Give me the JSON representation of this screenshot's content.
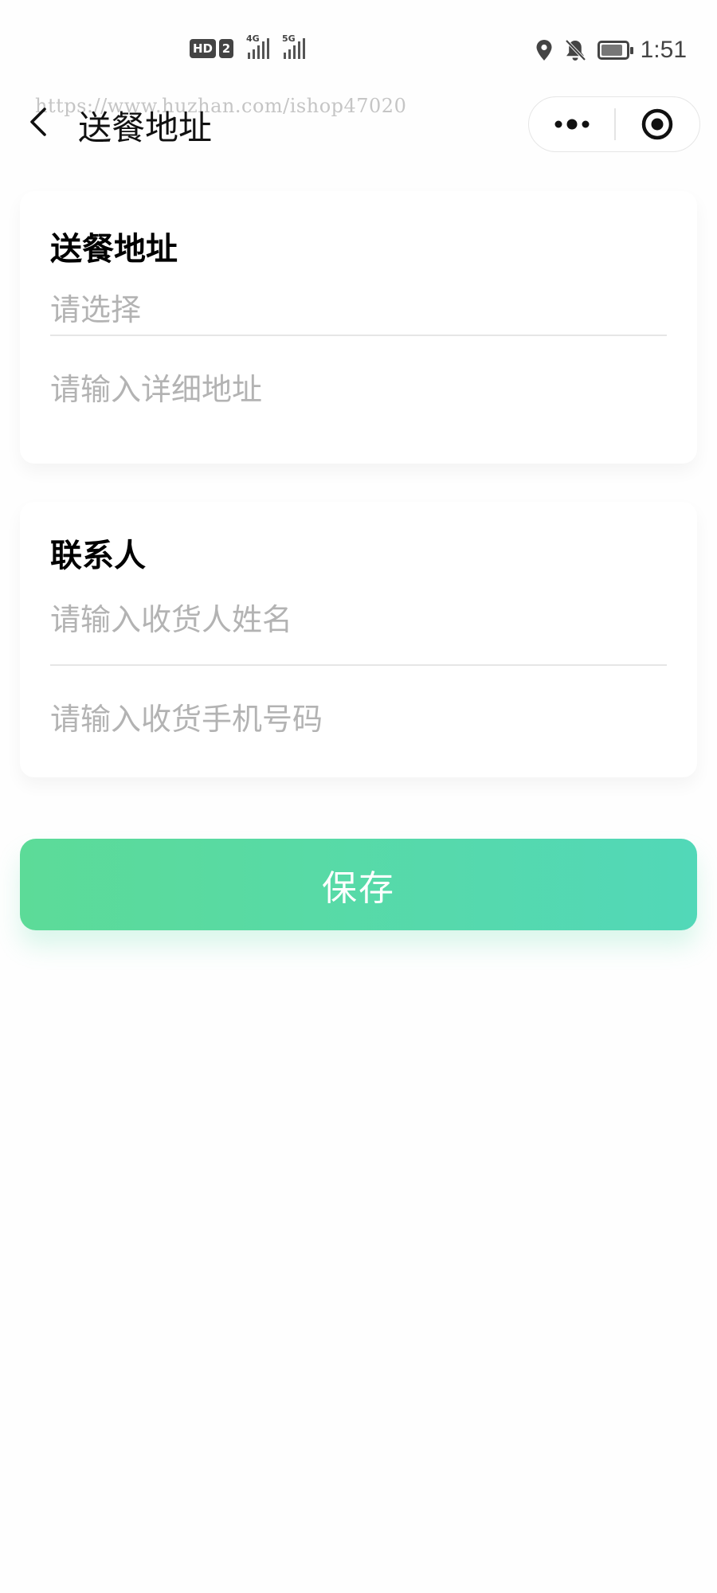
{
  "status_bar": {
    "hd": "HD",
    "sim": "2",
    "net1": "4G",
    "net2": "5G",
    "time": "1:51",
    "icons": [
      "location-icon",
      "bell-off-icon",
      "battery-icon"
    ]
  },
  "nav": {
    "title": "送餐地址",
    "watermark": "https://www.huzhan.com/ishop47020",
    "icons": [
      "back-icon",
      "more-icon",
      "close-target-icon"
    ]
  },
  "address_card": {
    "title": "送餐地址",
    "select_placeholder": "请选择",
    "detail_placeholder": "请输入详细地址"
  },
  "contact_card": {
    "title": "联系人",
    "name_placeholder": "请输入收货人姓名",
    "phone_placeholder": "请输入收货手机号码"
  },
  "save_label": "保存",
  "colors": {
    "save_gradient_start": "#5cdb98",
    "save_gradient_end": "#52d8b8",
    "placeholder": "#b3b3b3"
  }
}
